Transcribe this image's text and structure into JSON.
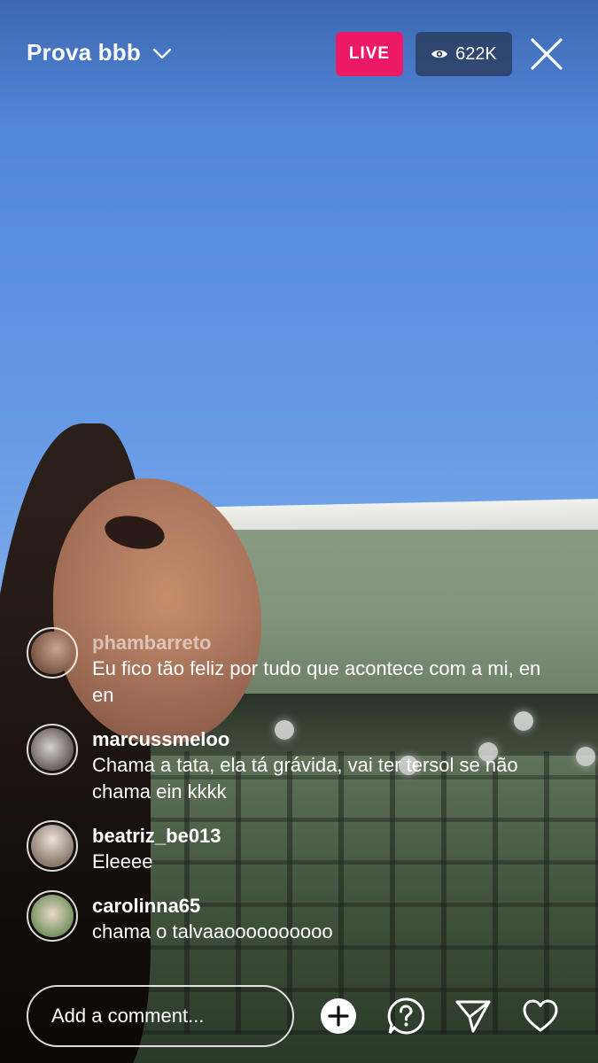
{
  "header": {
    "title": "Prova bbb",
    "live_label": "LIVE",
    "viewer_count": "622K"
  },
  "comments": [
    {
      "user": "phambarreto",
      "message": "Eu fico tão feliz por tudo que acontece com a mi, en en"
    },
    {
      "user": "marcussmeloo",
      "message": "Chama a tata, ela tá grávida, vai ter tersol se não chama ein kkkk"
    },
    {
      "user": "beatriz_be013",
      "message": "Eleeee"
    },
    {
      "user": "carolinna65",
      "message": "chama o talvaaoooooooooo"
    }
  ],
  "composer": {
    "placeholder": "Add a comment..."
  },
  "icons": {
    "title_dropdown": "chevron-down-icon",
    "viewers": "eye-icon",
    "close": "close-icon",
    "add": "add-circle-icon",
    "question": "question-icon",
    "share": "send-icon",
    "like": "heart-icon"
  },
  "colors": {
    "live_badge": "#ec1a66",
    "viewer_badge": "#28375580"
  }
}
